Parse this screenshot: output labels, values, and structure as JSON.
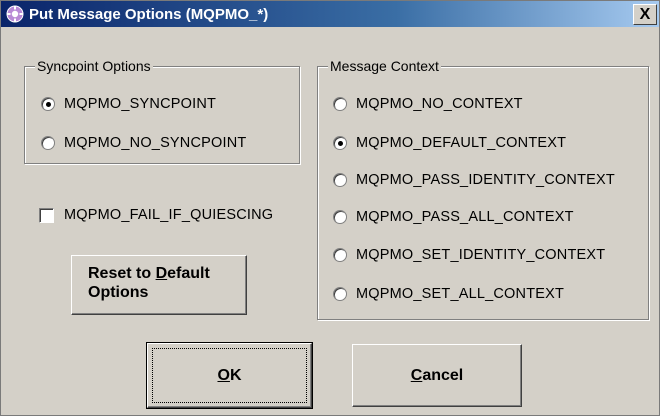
{
  "window": {
    "title": "Put Message Options (MQPMO_*)",
    "close_symbol": "X"
  },
  "syncpoint": {
    "title": "Syncpoint Options",
    "options": [
      {
        "label": "MQPMO_SYNCPOINT",
        "checked": true
      },
      {
        "label": "MQPMO_NO_SYNCPOINT",
        "checked": false
      }
    ]
  },
  "fail_if_quiescing": {
    "label": "MQPMO_FAIL_IF_QUIESCING",
    "checked": false
  },
  "context": {
    "title": "Message Context",
    "options": [
      {
        "label": "MQPMO_NO_CONTEXT",
        "checked": false
      },
      {
        "label": "MQPMO_DEFAULT_CONTEXT",
        "checked": true
      },
      {
        "label": "MQPMO_PASS_IDENTITY_CONTEXT",
        "checked": false
      },
      {
        "label": "MQPMO_PASS_ALL_CONTEXT",
        "checked": false
      },
      {
        "label": "MQPMO_SET_IDENTITY_CONTEXT",
        "checked": false
      },
      {
        "label": "MQPMO_SET_ALL_CONTEXT",
        "checked": false
      }
    ]
  },
  "buttons": {
    "reset_line1_pre": "Reset to ",
    "reset_line1_ul": "D",
    "reset_line1_post": "efault",
    "reset_line2": "Options",
    "ok_ul": "O",
    "ok_post": "K",
    "cancel_ul": "C",
    "cancel_post": "ancel"
  },
  "colors": {
    "titlebar_start": "#0a246a",
    "titlebar_end": "#a6caf0",
    "face": "#d4d0c8"
  },
  "icons": {
    "app": "mq-gear-icon"
  }
}
